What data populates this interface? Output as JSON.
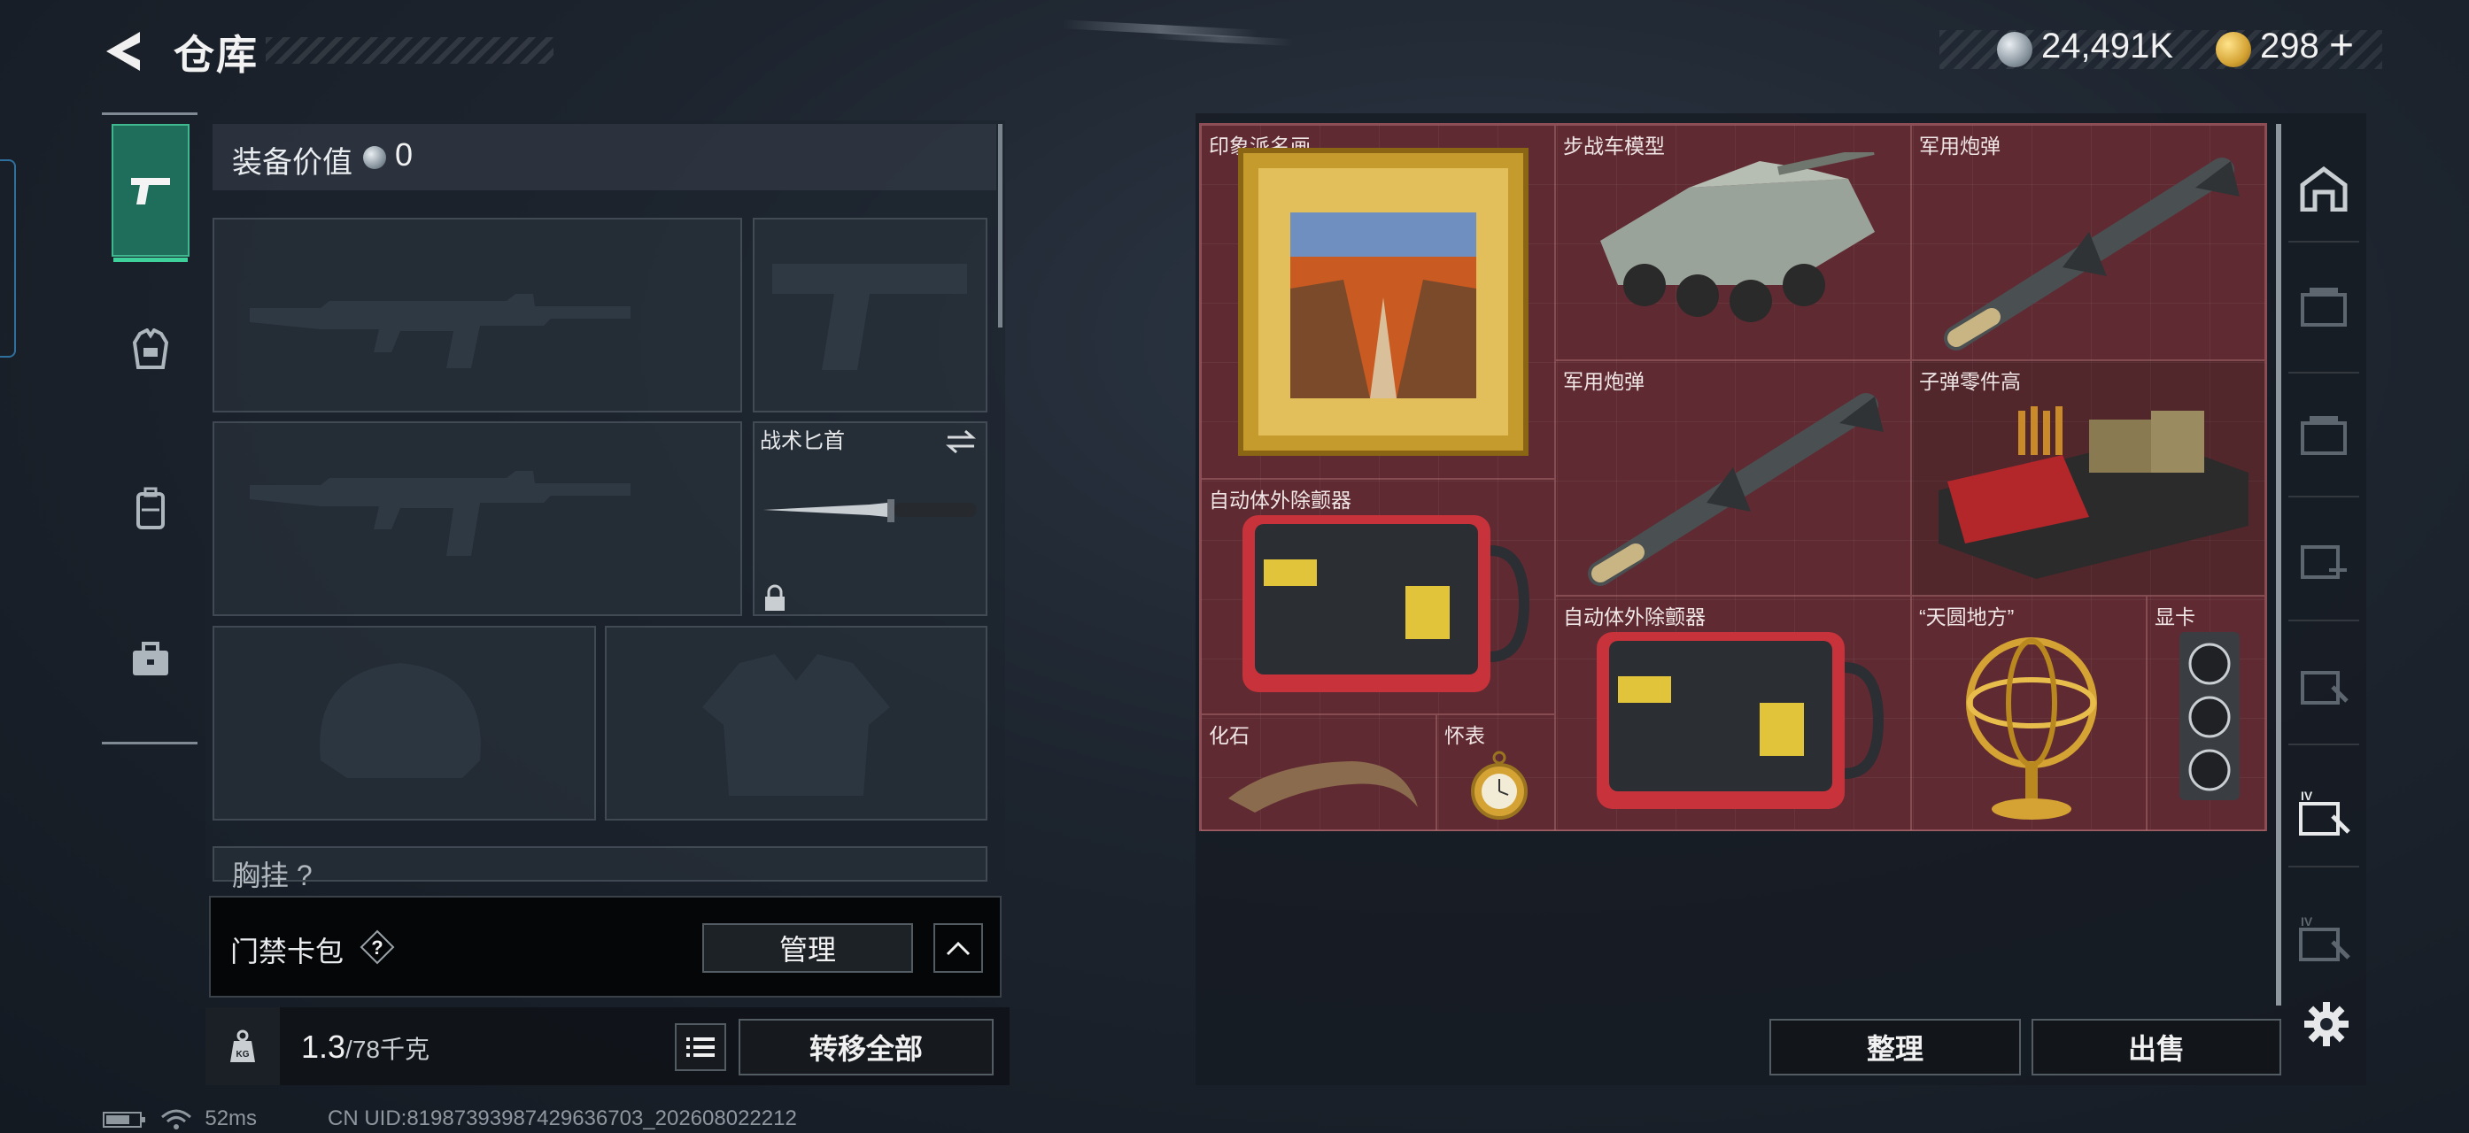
{
  "header": {
    "title": "仓库",
    "currency1_value": "24,491K",
    "currency2_value": "298",
    "plus": "+",
    "version": ""
  },
  "left_nav": [
    "weapon-tab",
    "bag-tab",
    "backpack-tab",
    "case-tab"
  ],
  "equipment": {
    "value_label": "装备价值",
    "value": "0",
    "slots": {
      "knife_label": "战术匕首",
      "chest_label": "胸挂 ?"
    }
  },
  "keycard": {
    "label": "门禁卡包",
    "help": "?",
    "manage": "管理"
  },
  "weight": {
    "current": "1.3",
    "capacity": "/78千克"
  },
  "actions": {
    "transfer_all": "转移全部",
    "sort": "整理",
    "sell": "出售"
  },
  "status": {
    "ping": "52ms",
    "uid": "CN UID:81987393987429636703_202608022212"
  },
  "stash_items": [
    {
      "label": "印象派名画",
      "icon": "painting-icon"
    },
    {
      "label": "步战车模型",
      "icon": "apc-model-icon"
    },
    {
      "label": "军用炮弹",
      "icon": "missile-icon"
    },
    {
      "label": "军用炮弹",
      "icon": "missile-icon"
    },
    {
      "label": "子弹零件高",
      "icon": "ammo-parts-icon"
    },
    {
      "label": "自动体外除颤器",
      "icon": "defibrillator-icon"
    },
    {
      "label": "自动体外除颤器",
      "icon": "defibrillator-icon"
    },
    {
      "label": "“天圆地方”",
      "icon": "armillary-sphere-icon"
    },
    {
      "label": "显卡",
      "icon": "graphics-card-icon"
    },
    {
      "label": "化石",
      "icon": "fossil-claw-icon"
    },
    {
      "label": "怀表",
      "icon": "pocket-watch-icon"
    }
  ],
  "colors": {
    "accent_green": "#1f6e5b",
    "stash_bg": "#5f2a31",
    "gold": "#d4a334"
  }
}
